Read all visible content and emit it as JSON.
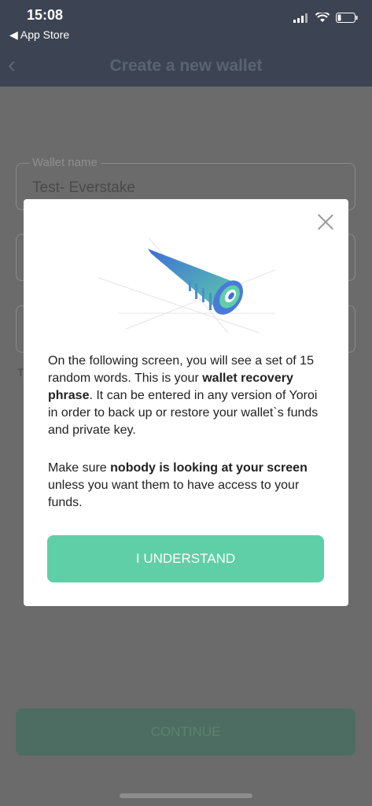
{
  "status_bar": {
    "time": "15:08",
    "back_app": "◀ App Store"
  },
  "header": {
    "title": "Create a new wallet"
  },
  "form": {
    "wallet_name_label": "Wallet name",
    "wallet_name_value": "Test- Everstake",
    "hidden_text_fragment": "T",
    "continue_label": "CONTINUE"
  },
  "modal": {
    "p1_a": "On the following screen, you will see a set of 15 random words. This is your ",
    "p1_b": "wallet recovery phrase",
    "p1_c": ". It can be entered in any version of Yoroi in order to back up or restore your wallet`s funds and private key.",
    "p2_a": "Make sure ",
    "p2_b": "nobody is looking at your screen",
    "p2_c": " unless you want them to have access to your funds.",
    "button_label": "I UNDERSTAND"
  },
  "colors": {
    "accent": "#5fcfa7",
    "header_bg": "#3c4453"
  },
  "icons": [
    "back-arrow-icon",
    "signal-icon",
    "wifi-icon",
    "battery-icon",
    "close-icon",
    "telescope-illustration"
  ]
}
